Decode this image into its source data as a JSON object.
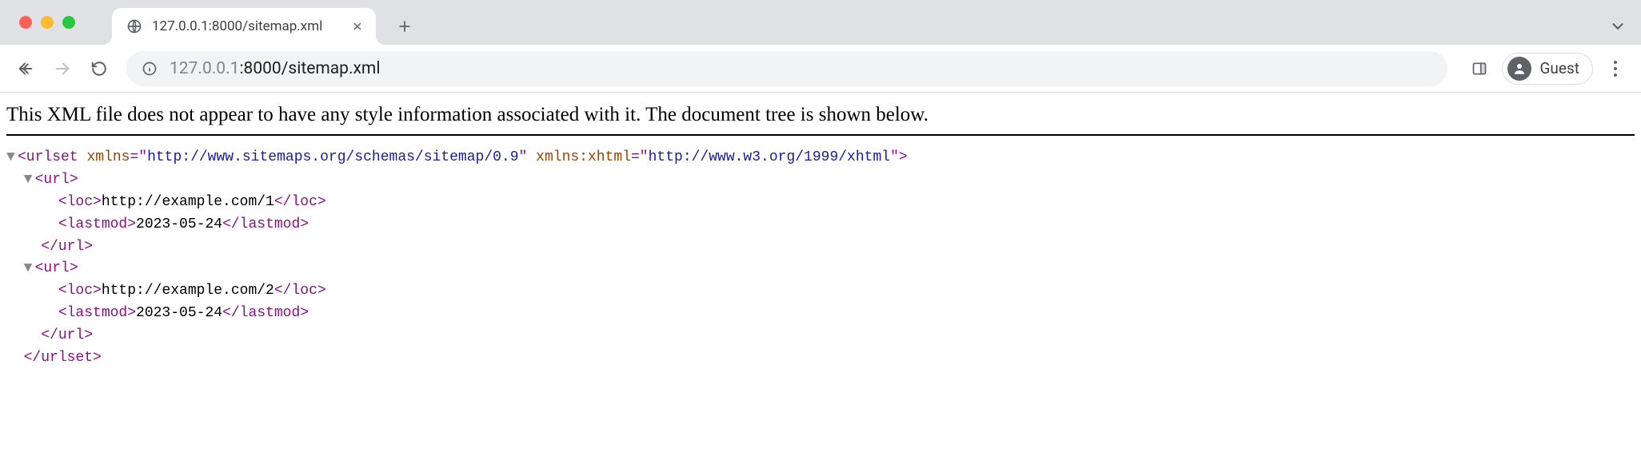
{
  "window": {
    "traffic_lights": {
      "red": "#ff5f57",
      "yellow": "#febc2e",
      "green": "#28c840"
    }
  },
  "tabstrip": {
    "tabs": [
      {
        "title": "127.0.0.1:8000/sitemap.xml",
        "favicon": "globe-icon"
      }
    ]
  },
  "toolbar": {
    "back_enabled": true,
    "forward_enabled": false,
    "url": {
      "scheme_host": "127.0.0.1",
      "port": ":8000",
      "path": "/sitemap.xml",
      "display_muted": "127.0.0.1",
      "display_dark": ":8000/sitemap.xml"
    },
    "profile_label": "Guest"
  },
  "viewer": {
    "notice": "This XML file does not appear to have any style information associated with it. The document tree is shown below.",
    "root": {
      "tag": "urlset",
      "attrs": [
        {
          "name": "xmlns",
          "value": "http://www.sitemaps.org/schemas/sitemap/0.9"
        },
        {
          "name": "xmlns:xhtml",
          "value": "http://www.w3.org/1999/xhtml"
        }
      ],
      "children": [
        {
          "tag": "url",
          "children": [
            {
              "tag": "loc",
              "text": "http://example.com/1"
            },
            {
              "tag": "lastmod",
              "text": "2023-05-24"
            }
          ]
        },
        {
          "tag": "url",
          "children": [
            {
              "tag": "loc",
              "text": "http://example.com/2"
            },
            {
              "tag": "lastmod",
              "text": "2023-05-24"
            }
          ]
        }
      ]
    }
  }
}
